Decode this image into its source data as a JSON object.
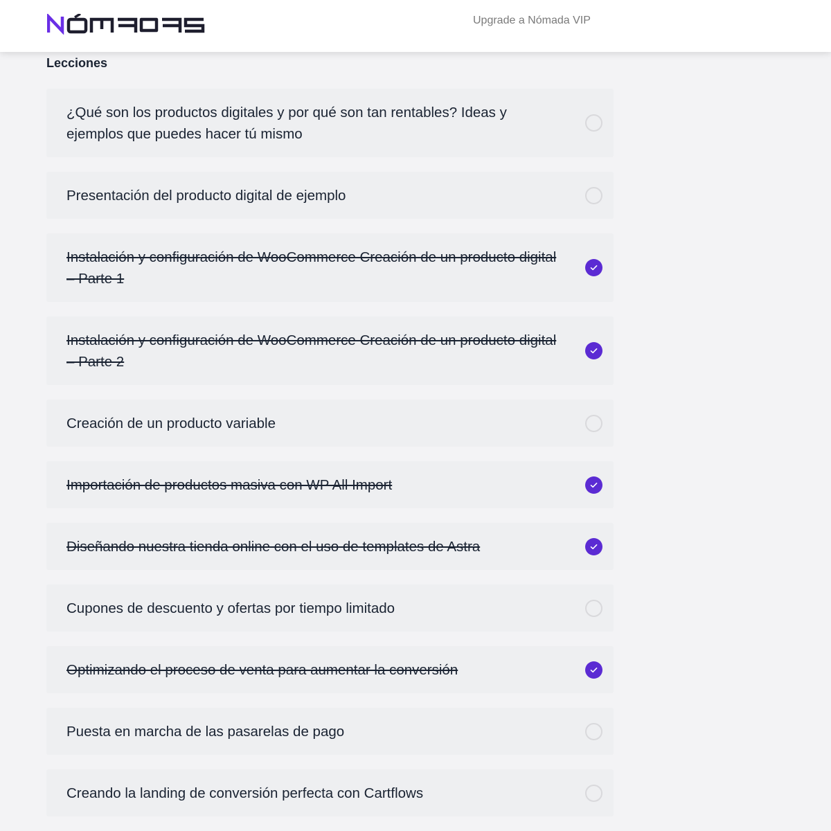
{
  "header": {
    "logo_text": "NÓMADAS",
    "upgrade_label": "Upgrade a Nómada VIP"
  },
  "colors": {
    "accent": "#5b2bd3",
    "logo_accent": "#6a2ee6",
    "text": "#1a2332",
    "background": "#f3f3f5",
    "card": "#eeeff1"
  },
  "lessons": {
    "title": "Lecciones",
    "items": [
      {
        "title": "¿Qué son los productos digitales y por qué son tan rentables? Ideas y ejemplos que puedes hacer tú mismo",
        "completed": false
      },
      {
        "title": "Presentación del producto digital de ejemplo",
        "completed": false
      },
      {
        "title": "Instalación y configuración de WooCommerce Creación de un producto digital – Parte 1",
        "completed": true
      },
      {
        "title": "Instalación y configuración de WooCommerce Creación de un producto digital – Parte 2",
        "completed": true
      },
      {
        "title": "Creación de un producto variable",
        "completed": false
      },
      {
        "title": "Importación de productos masiva con WP All Import",
        "completed": true
      },
      {
        "title": "Diseñando nuestra tienda online con el uso de templates de Astra",
        "completed": true
      },
      {
        "title": "Cupones de descuento y ofertas por tiempo limitado",
        "completed": false
      },
      {
        "title": "Optimizando el proceso de venta para aumentar la conversión",
        "completed": true
      },
      {
        "title": "Puesta en marcha de las pasarelas de pago",
        "completed": false
      },
      {
        "title": "Creando la landing de conversión perfecta con Cartflows",
        "completed": false
      }
    ]
  }
}
